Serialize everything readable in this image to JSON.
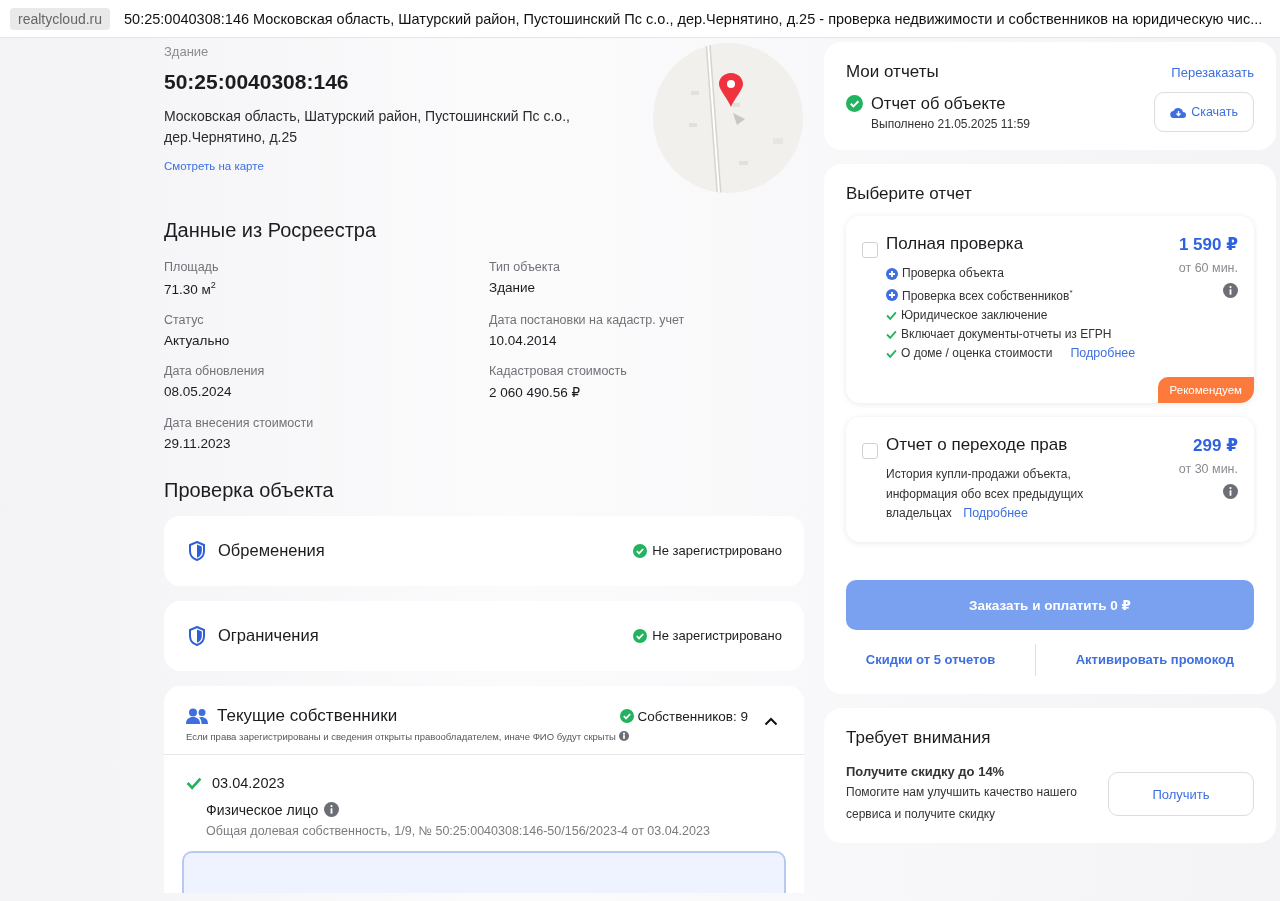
{
  "browser_bar": {
    "site": "realtycloud.ru",
    "title": "50:25:0040308:146 Московская область, Шатурский район, Пустошинский Пс с.о., дер.Чернятино, д.25 - проверка недвижимости и собственников на юридическую чис..."
  },
  "object": {
    "type_label": "Здание",
    "cadastral_number": "50:25:0040308:146",
    "address": "Московская область, Шатурский район, Пустошинский Пс с.о., дер.Чернятино, д.25",
    "map_link": "Смотреть на карте"
  },
  "registry": {
    "title": "Данные из Росреестра",
    "fields": [
      {
        "label": "Площадь",
        "value": "71.30 м$^{2}$"
      },
      {
        "label": "Тип объекта",
        "value": "Здание"
      },
      {
        "label": "Статус",
        "value": "Актуально"
      },
      {
        "label": "Дата постановки на кадастр. учет",
        "value": "10.04.2014"
      },
      {
        "label": "Дата обновления",
        "value": "08.05.2024"
      },
      {
        "label": "Кадастровая стоимость",
        "value": "2 060 490.56 ₽"
      },
      {
        "label": "Дата внесения стоимости",
        "value": "29.11.2023"
      }
    ]
  },
  "checks": {
    "title": "Проверка объекта",
    "items": [
      {
        "label": "Обременения",
        "status": "Не зарегистрировано",
        "ok": true
      },
      {
        "label": "Ограничения",
        "status": "Не зарегистрировано",
        "ok": true
      }
    ]
  },
  "owners": {
    "title": "Текущие собственники",
    "count": "Собственников: 9",
    "expanded": true,
    "note": "Если права зарегистрированы и сведения открыты правообладателем, иначе ФИО будут скрыты",
    "entries": [
      {
        "date": "03.04.2023",
        "type": "Физическое лицо",
        "details": "Общая долевая собственность, 1/9, № 50:25:0040308:146-50/156/2023-4 от 03.04.2023"
      }
    ]
  },
  "my_reports": {
    "title": "Мои отчеты",
    "reorder_link": "Перезаказать",
    "report": {
      "name": "Отчет об объекте",
      "status": "Выполнено 21.05.2025 11:59",
      "done": true
    },
    "download_button": "Скачать"
  },
  "choose": {
    "title": "Выберите отчет",
    "options": [
      {
        "name": "Полная проверка",
        "price": "1 590 ₽",
        "time": "от 60 мин.",
        "checked": false,
        "features": [
          {
            "kind": "plus",
            "text": "Проверка объекта"
          },
          {
            "kind": "plus",
            "text": "Проверка всех собственников$^{*}$"
          },
          {
            "kind": "check",
            "text": "Юридическое заключение"
          },
          {
            "kind": "check",
            "text": "Включает документы-отчеты из ЕГРН"
          },
          {
            "kind": "check",
            "text": "О доме / оценка стоимости",
            "link": "Подробнее"
          }
        ],
        "badge": "Рекомендуем"
      },
      {
        "name": "Отчет о переходе прав",
        "price": "299 ₽",
        "time": "от 30 мин.",
        "checked": false,
        "description": "История купли-продажи объекта, информация обо всех предыдущих владельцах",
        "link": "Подробнее"
      }
    ],
    "order_button": {
      "label": "Заказать и оплатить 0 ₽",
      "disabled": true
    },
    "links": [
      "Скидки от 5 отчетов",
      "Активировать промокод"
    ]
  },
  "attention": {
    "title": "Требует внимания",
    "headline": "Получите скидку до 14%",
    "text": "Помогите нам улучшить качество нашего сервиса и получите скидку",
    "button": "Получить"
  }
}
